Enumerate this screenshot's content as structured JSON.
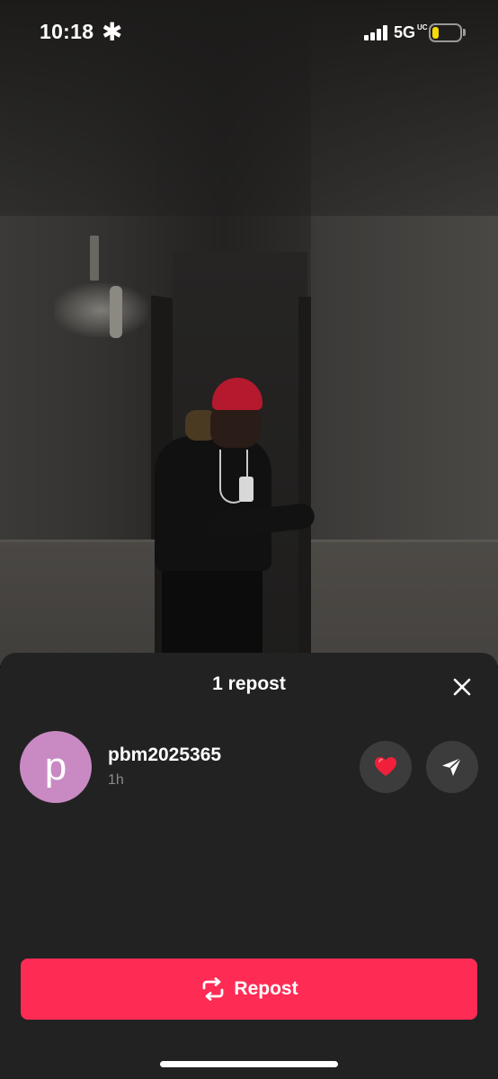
{
  "status_bar": {
    "time": "10:18",
    "activity_symbol": "✱",
    "network": "5G",
    "network_superscript": "UC",
    "battery_level": 0.2,
    "battery_color": "#f5d90a"
  },
  "video": {
    "description_icon": "video-frame"
  },
  "sheet": {
    "title": "1 repost",
    "close_icon": "close-icon",
    "reposts": [
      {
        "avatar_letter": "p",
        "avatar_color": "#c98ac4",
        "username": "pbm2025365",
        "time_ago": "1h",
        "like_icon": "heart-icon",
        "send_icon": "send-icon"
      }
    ],
    "repost_button": {
      "label": "Repost",
      "icon": "repost-icon",
      "color": "#fe2c55"
    }
  }
}
